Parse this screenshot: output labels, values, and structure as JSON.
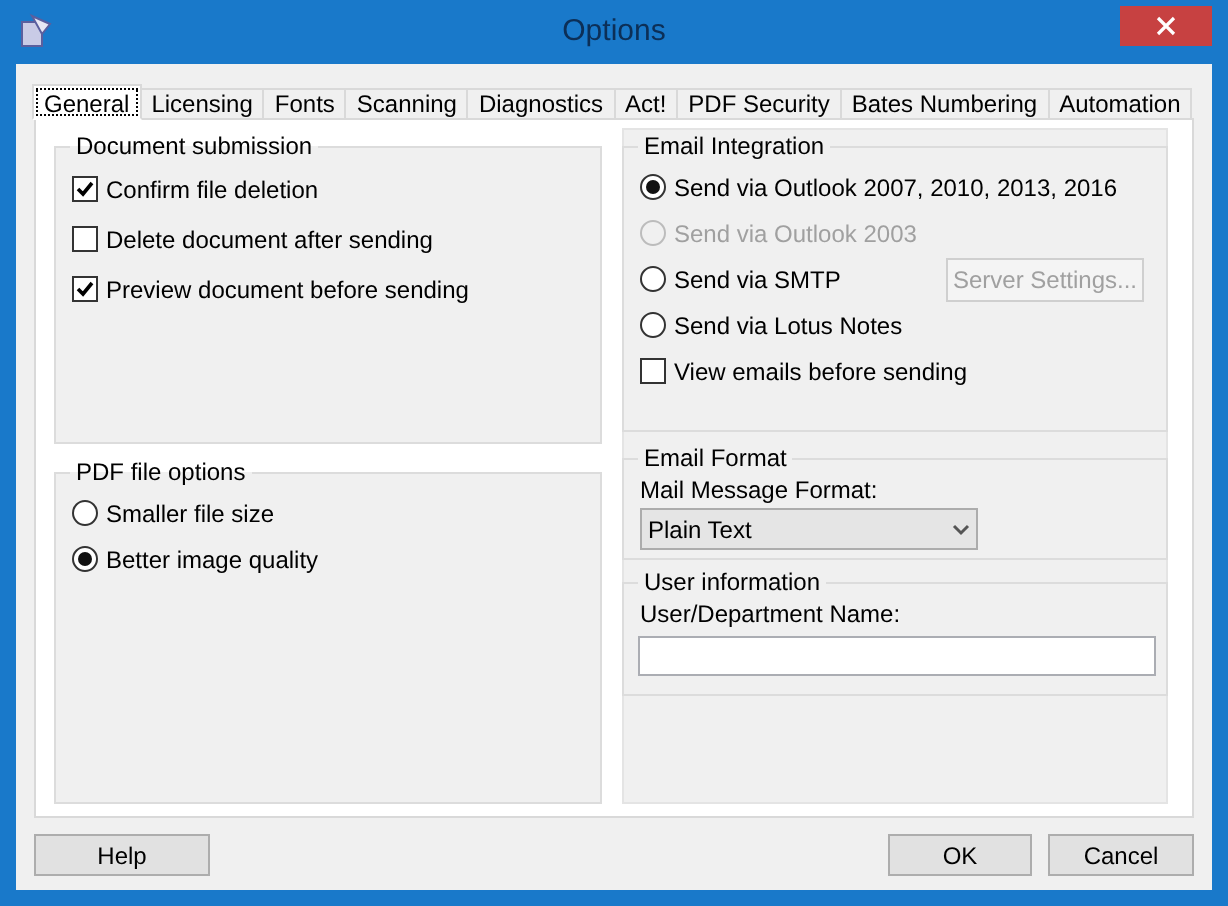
{
  "window": {
    "title": "Options"
  },
  "tabs": [
    {
      "label": "General",
      "selected": true
    },
    {
      "label": "Licensing",
      "selected": false
    },
    {
      "label": "Fonts",
      "selected": false
    },
    {
      "label": "Scanning",
      "selected": false
    },
    {
      "label": "Diagnostics",
      "selected": false
    },
    {
      "label": "Act!",
      "selected": false
    },
    {
      "label": "PDF Security",
      "selected": false
    },
    {
      "label": "Bates Numbering",
      "selected": false
    },
    {
      "label": "Automation",
      "selected": false
    }
  ],
  "document_submission": {
    "title": "Document submission",
    "items": [
      {
        "kind": "checkbox",
        "label": "Confirm file deletion",
        "checked": true
      },
      {
        "kind": "checkbox",
        "label": "Delete document after sending",
        "checked": false
      },
      {
        "kind": "checkbox",
        "label": "Preview document before sending",
        "checked": true
      }
    ]
  },
  "pdf_file_options": {
    "title": "PDF file options",
    "items": [
      {
        "kind": "radio",
        "label": "Smaller file size",
        "selected": false
      },
      {
        "kind": "radio",
        "label": "Better image quality",
        "selected": true
      }
    ]
  },
  "email_integration": {
    "title": "Email Integration",
    "items": [
      {
        "kind": "radio",
        "label": "Send via Outlook 2007, 2010, 2013, 2016",
        "selected": true,
        "disabled": false
      },
      {
        "kind": "radio",
        "label": "Send via Outlook 2003",
        "selected": false,
        "disabled": true
      },
      {
        "kind": "radio",
        "label": "Send via SMTP",
        "selected": false,
        "disabled": false,
        "button": {
          "label": "Server Settings...",
          "disabled": true
        }
      },
      {
        "kind": "radio",
        "label": "Send via Lotus Notes",
        "selected": false,
        "disabled": false
      },
      {
        "kind": "checkbox",
        "label": "View emails before sending",
        "checked": false,
        "disabled": false
      }
    ]
  },
  "email_format": {
    "title": "Email Format",
    "field_label": "Mail Message Format:",
    "value": "Plain Text"
  },
  "user_information": {
    "title": "User information",
    "field_label": "User/Department Name:"
  },
  "buttons": {
    "help": "Help",
    "ok": "OK",
    "cancel": "Cancel"
  }
}
